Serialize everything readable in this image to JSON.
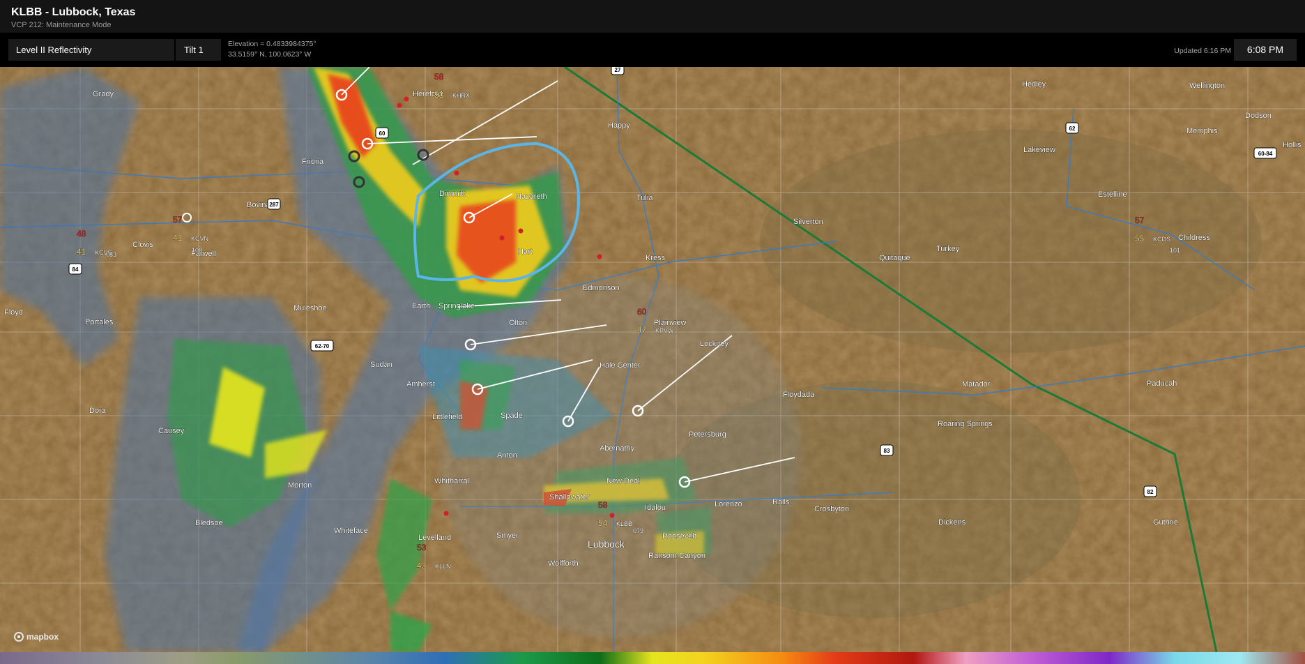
{
  "header": {
    "title": "KLBB - Lubbock, Texas",
    "subtitle": "VCP 212: Maintenance Mode"
  },
  "toolbar": {
    "product": "Level II Reflectivity",
    "tilt": "Tilt 1",
    "elevation": "Elevation = 0.4833984375°",
    "coordinates": "33.5159° N, 100.0623° W",
    "updated": "Updated 6:16 PM",
    "time": "6:08 PM"
  },
  "map": {
    "attribution": "mapbox",
    "places": [
      "Grady",
      "Hereford",
      "Happy",
      "Hedley",
      "Wellington",
      "Dodson",
      "Memphis",
      "Hollis",
      "Friona",
      "Lakeview",
      "Bovina",
      "Dimmitt",
      "Nazareth",
      "Tulia",
      "Silverton",
      "Estelline",
      "Clovis",
      "Farwell",
      "Childress",
      "Kress",
      "Turkey",
      "Quitaque",
      "Hart",
      "Edmonson",
      "Floyd",
      "Portales",
      "Muleshoe",
      "Earth",
      "Springlake",
      "Olton",
      "Plainview",
      "Lockney",
      "Sudan",
      "Amherst",
      "Hale Center",
      "Floydada",
      "Matador",
      "Paducah",
      "Dora",
      "Littlefield",
      "Spade",
      "Roaring Springs",
      "Causey",
      "Anton",
      "Petersburg",
      "Abernathy",
      "Morton",
      "Whitharral",
      "New Deal",
      "Shallowater",
      "Idalou",
      "Lorenzo",
      "Ralls",
      "Crosbyton",
      "Dickens",
      "Guthrie",
      "Bledsoe",
      "Whiteface",
      "Levelland",
      "Smyer",
      "Lubbock",
      "Roosevelt",
      "Ransom Canyon",
      "Wolfforth"
    ],
    "stations": [
      {
        "id": "KHRX",
        "temp": "58",
        "dew": "53"
      },
      {
        "id": "KCVN",
        "temp": "57",
        "dew": "41"
      },
      {
        "id": "KCVS",
        "temp": "48",
        "dew": "41"
      },
      {
        "id": "KPVW",
        "temp": "60",
        "dew": "47"
      },
      {
        "id": "KCDS",
        "temp": "57",
        "dew": "55"
      },
      {
        "id": "KLBB",
        "temp": "58",
        "dew": "54"
      },
      {
        "id": "KLLN",
        "temp": "53",
        "dew": "43"
      }
    ],
    "station_pressures": [
      "108",
      "083",
      "101",
      "079"
    ],
    "highways": [
      "27",
      "60",
      "287",
      "62",
      "60-84",
      "84",
      "62-70",
      "83",
      "82"
    ],
    "colors": {
      "terrain": "#8b6b3a",
      "county_line": "#cfcfcf",
      "road": "#2f7bd1",
      "warning_polygon": "#5ab6e8",
      "boundary": "#1a7a36"
    }
  }
}
